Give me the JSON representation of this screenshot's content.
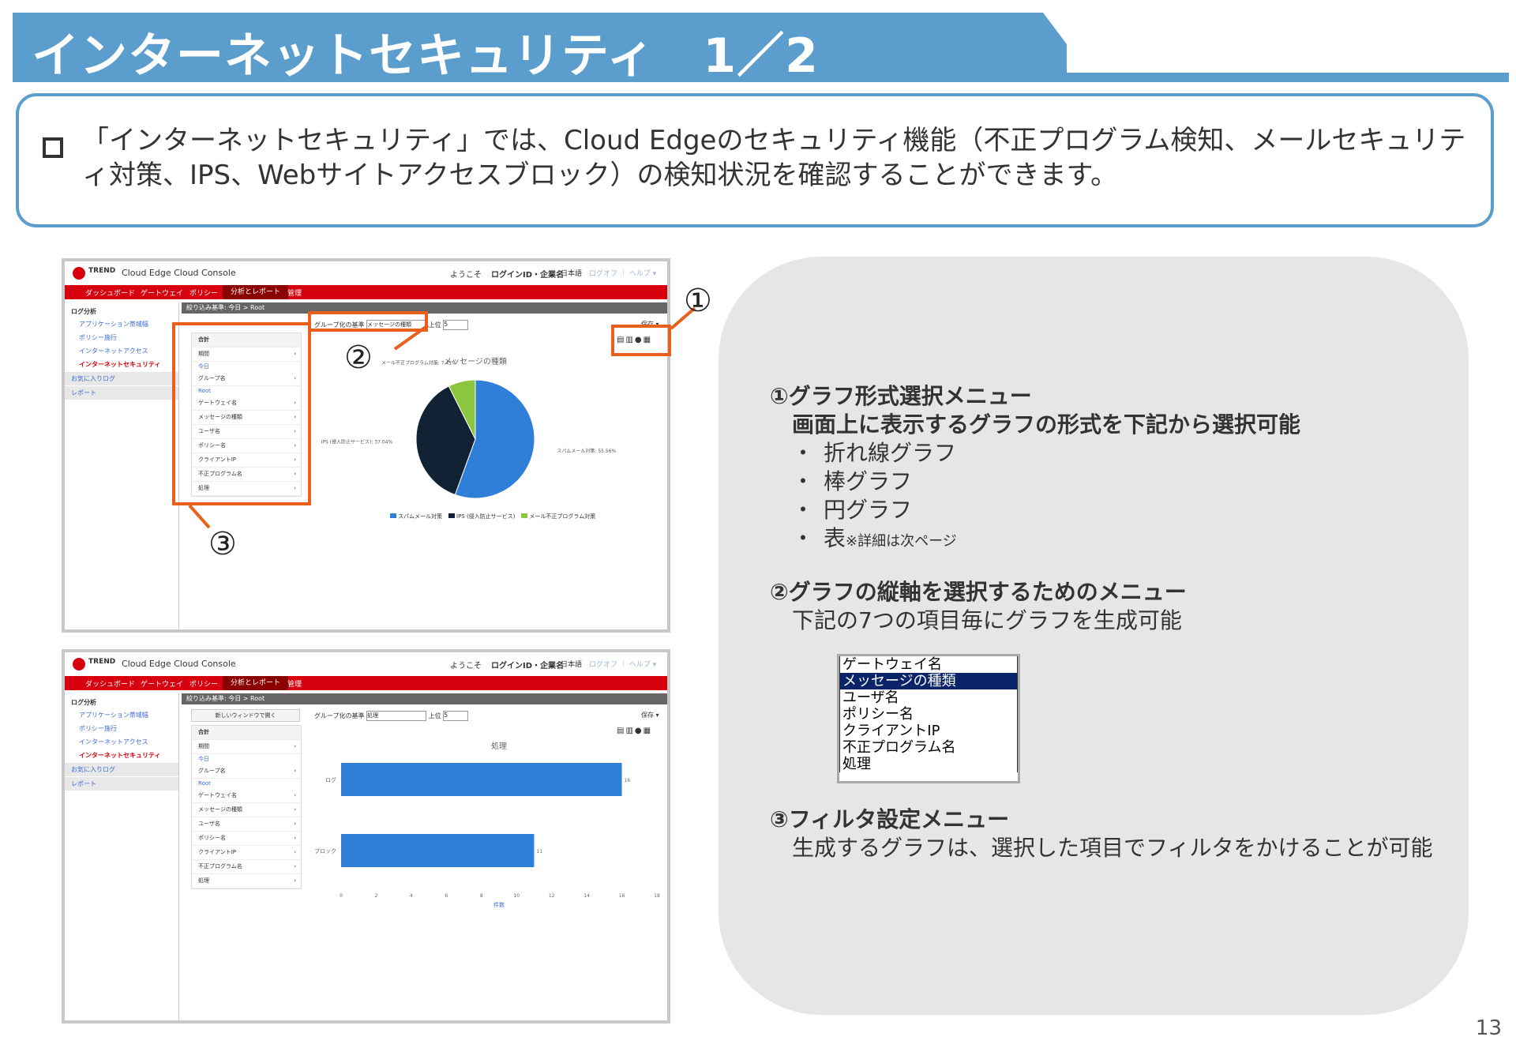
{
  "slide": {
    "title": "インターネットセキュリティ　1／2",
    "intro": "「インターネットセキュリティ」では、Cloud Edgeのセキュリティ機能（不正プログラム検知、メールセキュリティ対策、IPS、Webサイトアクセスブロック）の検知状況を確認することができます。",
    "page_number": "13"
  },
  "console": {
    "brand": "TREND",
    "app_title": "Cloud Edge Cloud Console",
    "welcome": "ようこそ",
    "user": "ログインID・企業名",
    "lang": "日本語",
    "links": "ログオフ ｜ ヘルプ ▾",
    "nav": [
      "ダッシュボード",
      "ゲートウェイ",
      "ポリシー",
      "分析とレポート",
      "管理"
    ],
    "sidebar": [
      "ログ分析",
      "アプリケーション帯域幅",
      "ポリシー施行",
      "インターネットアクセス",
      "インターネットセキュリティ",
      "お気に入りログ",
      "レポート"
    ],
    "breadcrumb": "絞り込み基準: 今日 > Root",
    "filter_header": "合計",
    "filter_items": [
      {
        "label": "期間",
        "sub": "今日"
      },
      {
        "label": "グループ名",
        "sub": "Root"
      },
      {
        "label": "ゲートウェイ名",
        "sub": ""
      },
      {
        "label": "メッセージの種類",
        "sub": ""
      },
      {
        "label": "ユーザ名",
        "sub": ""
      },
      {
        "label": "ポリシー名",
        "sub": ""
      },
      {
        "label": "クライアントIP",
        "sub": ""
      },
      {
        "label": "不正プログラム名",
        "sub": ""
      },
      {
        "label": "処理",
        "sub": ""
      }
    ],
    "group_by_label": "グループ化の基準",
    "group_by_value_1": "メッセージの種類",
    "group_by_value_2": "処理",
    "top_label": "上位",
    "top_value": "5",
    "save_label": "保存 ▾",
    "new_window": "新しいウィンドウで開く"
  },
  "chart_data": [
    {
      "type": "pie",
      "title": "メッセージの種類",
      "categories": [
        "スパムメール対策",
        "IPS (侵入防止サービス)",
        "メール不正プログラム対策"
      ],
      "values": [
        55.56,
        37.04,
        7.41
      ],
      "labels": [
        "スパムメール対策: 55.56%",
        "IPS (侵入防止サービス): 37.04%",
        "メール不正プログラム対策: 7.41%"
      ],
      "colors": [
        "#2f7fd8",
        "#122235",
        "#8cc63f"
      ],
      "legend": "bottom"
    },
    {
      "type": "bar",
      "orientation": "horizontal",
      "title": "処理",
      "categories": [
        "ログ",
        "ブロック"
      ],
      "values": [
        16,
        11
      ],
      "xlabel": "件数",
      "xlim": [
        0,
        18
      ],
      "xticks": [
        0,
        2,
        4,
        6,
        8,
        10,
        12,
        14,
        16,
        18
      ],
      "color": "#2f7fd8"
    }
  ],
  "callouts": {
    "one": "①",
    "two": "②",
    "three": "③"
  },
  "panel": {
    "item1_title": "①グラフ形式選択メニュー",
    "item1_subtitle": "画面上に表示するグラフの形式を下記から選択可能",
    "item1_options": [
      "折れ線グラフ",
      "棒グラフ",
      "円グラフ"
    ],
    "item1_last_option": "表",
    "item1_last_note": "※詳細は次ページ",
    "item2_title": "②グラフの縦軸を選択するためのメニュー",
    "item2_desc": "下記の7つの項目毎にグラフを生成可能",
    "item2_list": [
      "ゲートウェイ名",
      "メッセージの種類",
      "ユーザ名",
      "ポリシー名",
      "クライアントIP",
      "不正プログラム名",
      "処理"
    ],
    "item2_selected_index": 1,
    "item3_title": "③フィルタ設定メニュー",
    "item3_desc": "生成するグラフは、選択した項目でフィルタをかけることが可能"
  }
}
